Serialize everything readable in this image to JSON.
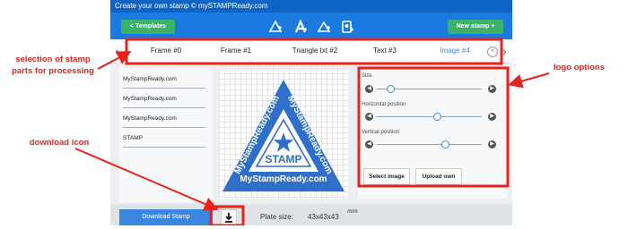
{
  "app": {
    "title": "Create your own stamp © mySTAMPReady.com",
    "templates_button": "<  Templates",
    "new_stamp_button": "New stamp +",
    "tools": [
      "add-frame-icon",
      "add-text-icon",
      "add-triangle-text-icon",
      "add-image-icon"
    ]
  },
  "tabs": {
    "items": [
      {
        "label": "Frame #0"
      },
      {
        "label": "Frame #1"
      },
      {
        "label": "Triangle txt #2"
      },
      {
        "label": "Text #3"
      },
      {
        "label": "Image #4"
      }
    ],
    "active_index": 4,
    "close_symbol": "✕"
  },
  "text_fields": [
    "MyStampReady.com",
    "MyStampReady.com",
    "MyStampReady.com",
    "STAMP"
  ],
  "stamp": {
    "outer_text": "MyStampReady.com",
    "center_text": "STAMP",
    "color": "#2f6fc9"
  },
  "logo_options": {
    "size_label": "Size",
    "size_value": 0.14,
    "horizontal_label": "Horizontal position",
    "horizontal_value": 0.58,
    "vertical_label": "Vertical position",
    "vertical_value": 0.66,
    "select_image_button": "Select image",
    "upload_own_button": "Upload own"
  },
  "bottom": {
    "download_button": "Download Stamp",
    "plate_size_label": "Plate size:",
    "plate_size_value": "43x43x43",
    "plate_size_unit": "/mm"
  },
  "annotations": {
    "parts_selection": "selection of stamp parts for processing",
    "logo_options": "logo options",
    "download_icon": "download icon",
    "color": "#e8221b"
  }
}
